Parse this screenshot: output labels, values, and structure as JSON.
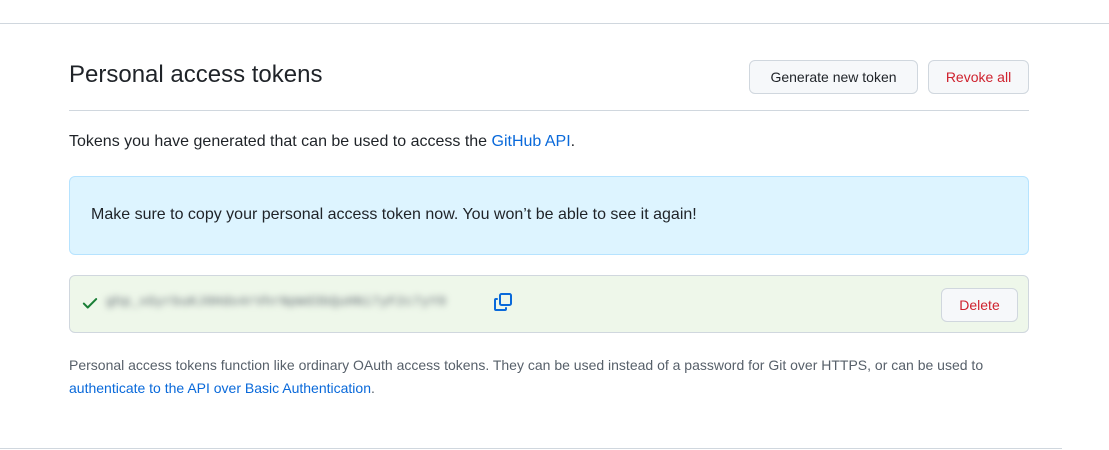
{
  "header": {
    "title": "Personal access tokens",
    "generate_label": "Generate new token",
    "revoke_all_label": "Revoke all"
  },
  "intro": {
    "text": "Tokens you have generated that can be used to access the ",
    "link": "GitHub API",
    "suffix": "."
  },
  "flash": {
    "message": "Make sure to copy your personal access token now. You won’t be able to see it again!"
  },
  "token": {
    "value": "ghp_xGyrbuKJ0Hdo4rVhrNpWd3bQuHNi7yF2c7yY9",
    "delete_label": "Delete",
    "check_color": "#1a7f37",
    "copy_color": "#0969da"
  },
  "footnote": {
    "text": "Personal access tokens function like ordinary OAuth access tokens. They can be used instead of a password for Git over HTTPS, or can be used to ",
    "link": "authenticate to the API over Basic Authentication",
    "suffix": "."
  },
  "colors": {
    "accent": "#0969da",
    "danger": "#cf222e",
    "flash_bg": "#ddf4ff",
    "token_bg": "#eef7ea"
  }
}
